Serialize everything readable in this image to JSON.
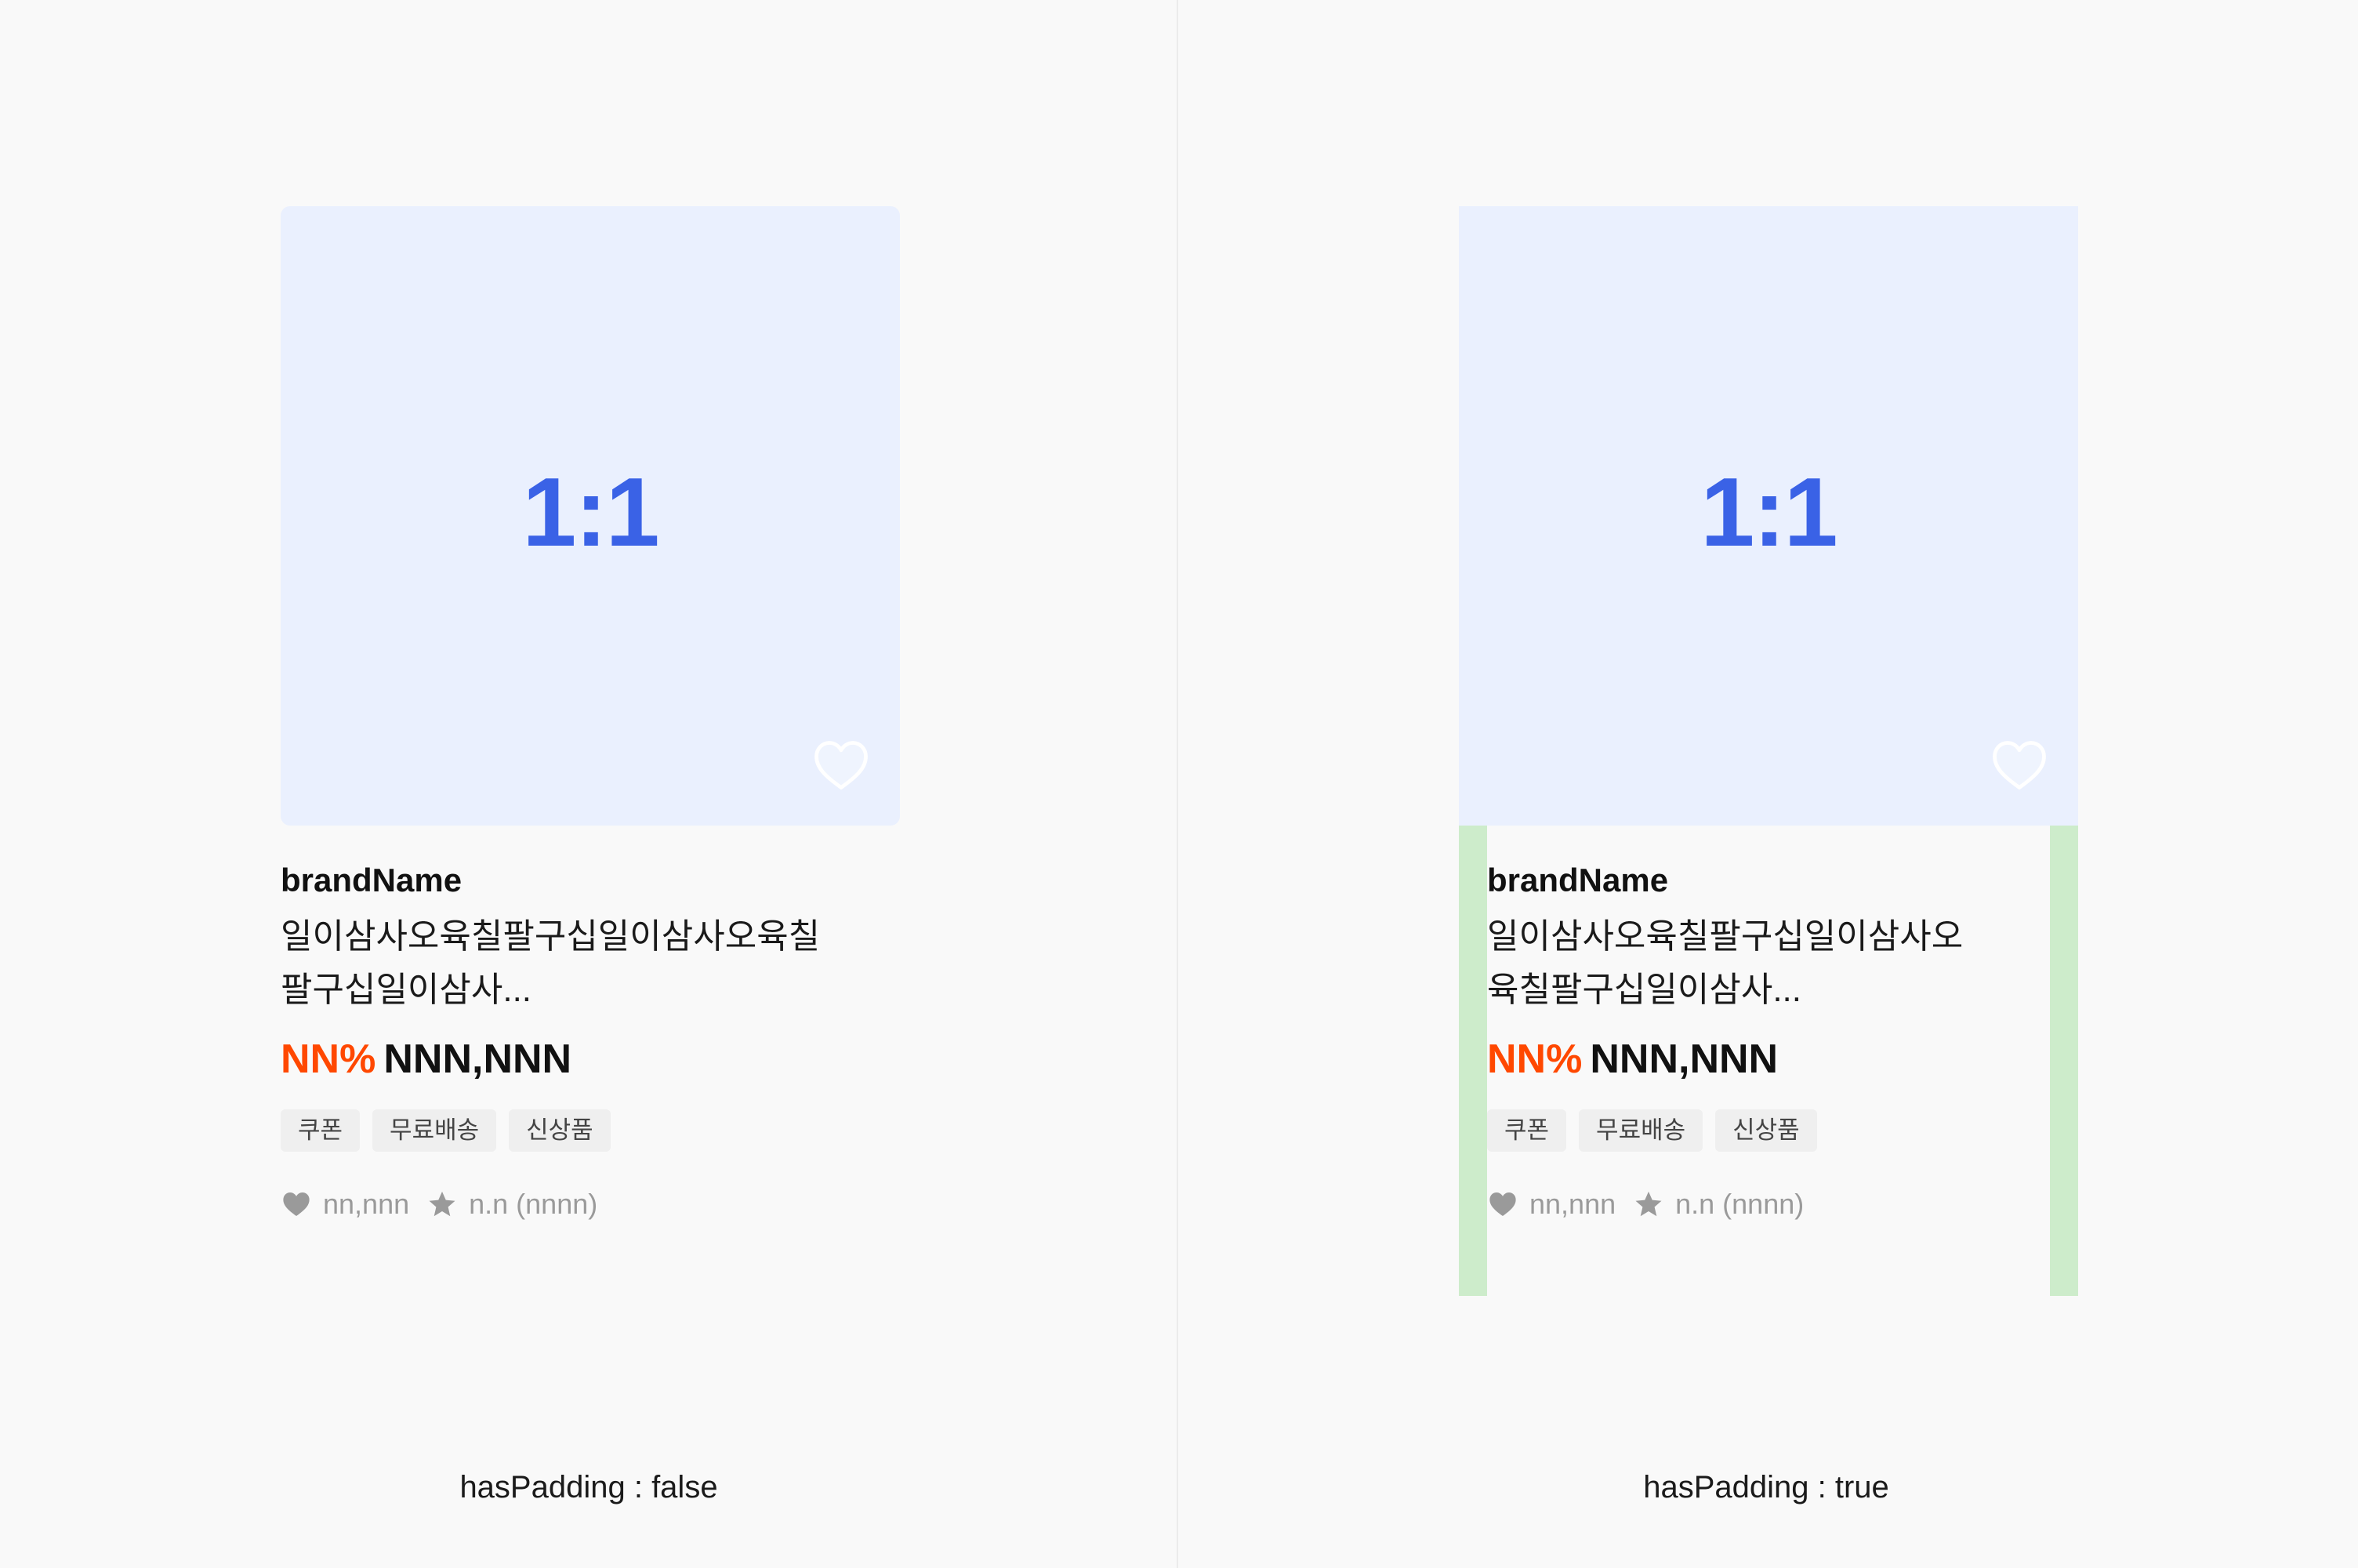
{
  "variants": [
    {
      "caption": "hasPadding : false",
      "card": {
        "ratio_label": "1:1",
        "brand": "brandName",
        "title": "일이삼사오육칠팔구십일이삼사오육칠팔구십일이삼사...",
        "discount": "NN%",
        "price": "NNN,NNN",
        "tags": [
          "쿠폰",
          "무료배송",
          "신상품"
        ],
        "likes": "nn,nnn",
        "rating": "n.n (nnnn)"
      }
    },
    {
      "caption": "hasPadding : true",
      "card": {
        "ratio_label": "1:1",
        "brand": "brandName",
        "title": "일이삼사오육칠팔구십일이삼사오육칠팔구십일이삼사...",
        "discount": "NN%",
        "price": "NNN,NNN",
        "tags": [
          "쿠폰",
          "무료배송",
          "신상품"
        ],
        "likes": "nn,nnn",
        "rating": "n.n (nnnn)"
      }
    }
  ],
  "icons": {
    "wish": "heart-outline-icon",
    "likes": "heart-filled-icon",
    "rating": "star-icon"
  },
  "colors": {
    "background": "#f9f9f9",
    "thumbnail": "#eaf0fe",
    "ratio_text": "#3a62e6",
    "discount": "#ff4800",
    "padding_guide": "#cdeccb",
    "tag_background": "#efefef",
    "meta_text": "#9a9a9a"
  }
}
